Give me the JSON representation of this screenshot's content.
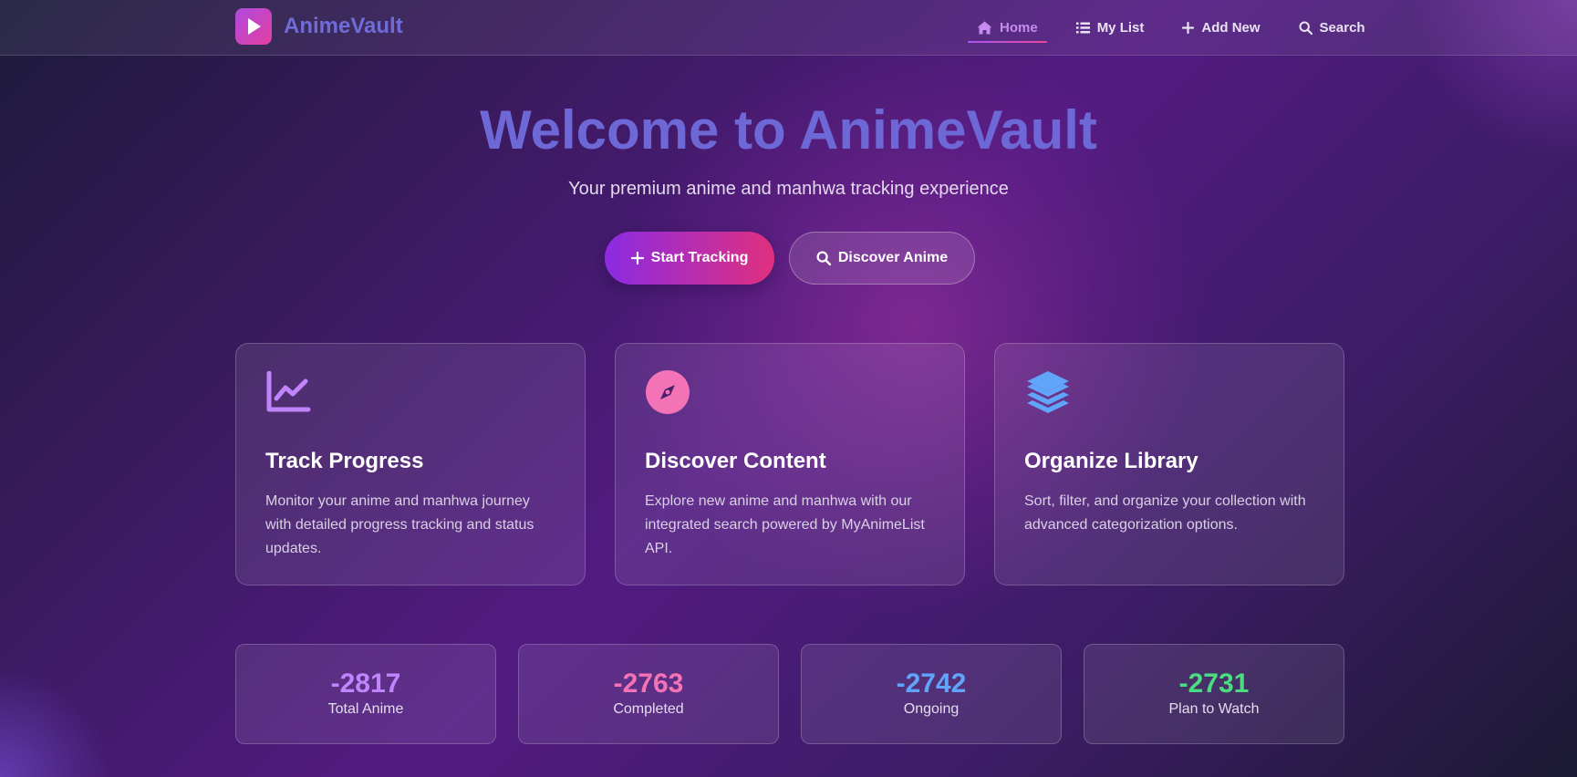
{
  "brand": {
    "name": "AnimeVault",
    "icon": "play-icon"
  },
  "nav": {
    "items": [
      {
        "label": "Home",
        "icon": "home-icon",
        "active": true
      },
      {
        "label": "My List",
        "icon": "list-icon",
        "active": false
      },
      {
        "label": "Add New",
        "icon": "plus-icon",
        "active": false
      },
      {
        "label": "Search",
        "icon": "search-icon",
        "active": false
      }
    ]
  },
  "hero": {
    "title": "Welcome to AnimeVault",
    "subtitle": "Your premium anime and manhwa tracking experience",
    "primary_button": "Start Tracking",
    "secondary_button": "Discover Anime"
  },
  "features": [
    {
      "icon": "chart-line-icon",
      "title": "Track Progress",
      "description": "Monitor your anime and manhwa journey with detailed progress tracking and status updates."
    },
    {
      "icon": "compass-icon",
      "title": "Discover Content",
      "description": "Explore new anime and manhwa with our integrated search powered by MyAnimeList API."
    },
    {
      "icon": "layers-icon",
      "title": "Organize Library",
      "description": "Sort, filter, and organize your collection with advanced categorization options."
    }
  ],
  "stats": [
    {
      "value": "-2817",
      "label": "Total Anime",
      "color": "#c084fc"
    },
    {
      "value": "-2763",
      "label": "Completed",
      "color": "#f472b6"
    },
    {
      "value": "-2742",
      "label": "Ongoing",
      "color": "#60a5fa"
    },
    {
      "value": "-2731",
      "label": "Plan to Watch",
      "color": "#4ade80"
    }
  ],
  "colors": {
    "accent_purple": "#a855f7",
    "accent_pink": "#ec4899",
    "brand_text": "#6f6cd8"
  }
}
